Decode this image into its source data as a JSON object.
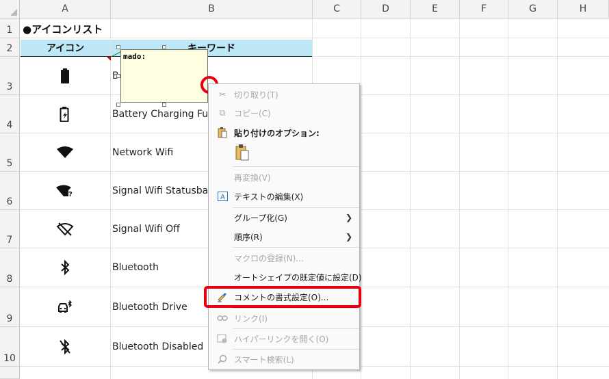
{
  "columns": [
    "A",
    "B",
    "C",
    "D",
    "E",
    "F",
    "G",
    "H"
  ],
  "rows": [
    "1",
    "2",
    "3",
    "4",
    "5",
    "6",
    "7",
    "8",
    "9",
    "10"
  ],
  "sheet": {
    "title": "●アイコンリスト",
    "header_icon": "アイコン",
    "header_keyword": "キーワード",
    "header_color": "#bde6f7",
    "items": [
      {
        "icon": "battery-icon",
        "keyword": "B"
      },
      {
        "icon": "battery-charging-icon",
        "keyword": "Battery Charging Ful"
      },
      {
        "icon": "wifi-icon",
        "keyword": "Network Wifi"
      },
      {
        "icon": "wifi-question-icon",
        "keyword": "Signal Wifi Statusba"
      },
      {
        "icon": "wifi-off-icon",
        "keyword": "Signal Wifi Off"
      },
      {
        "icon": "bluetooth-icon",
        "keyword": "Bluetooth"
      },
      {
        "icon": "bluetooth-drive-icon",
        "keyword": "Bluetooth Drive"
      },
      {
        "icon": "bluetooth-disabled-icon",
        "keyword": "Bluetooth Disabled"
      }
    ]
  },
  "comment": {
    "text": "mado:",
    "background": "#ffffe1"
  },
  "context_menu": {
    "cut": "切り取り(T)",
    "copy": "コピー(C)",
    "paste_options": "貼り付けのオプション:",
    "reconvert": "再変換(V)",
    "edit_text": "テキストの編集(X)",
    "group": "グループ化(G)",
    "order": "順序(R)",
    "assign_macro": "マクロの登録(N)...",
    "set_default_shape": "オートシェイプの既定値に設定(D)",
    "format_comment": "コメントの書式設定(O)...",
    "link": "リンク(I)",
    "open_hyperlink": "ハイパーリンクを開く(O)",
    "smart_lookup": "スマート検索(L)"
  },
  "highlight_color": "#e60012"
}
